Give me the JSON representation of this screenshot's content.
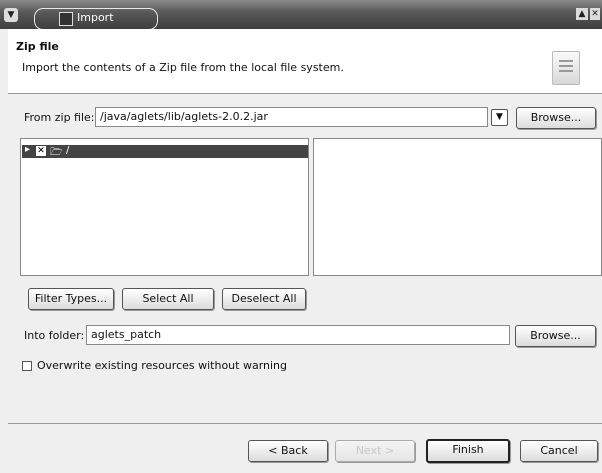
{
  "window": {
    "title": "Import"
  },
  "header": {
    "title": "Zip file",
    "description": "Import the contents of a Zip file from the local file system."
  },
  "source": {
    "label": "From zip file:",
    "value": "/java/aglets/lib/aglets-2.0.2.jar",
    "browse_label": "Browse..."
  },
  "tree": {
    "items": [
      {
        "label": "/",
        "checked": true,
        "expanded": false
      }
    ]
  },
  "buttons": {
    "filter_types": "Filter Types...",
    "select_all": "Select All",
    "deselect_all": "Deselect All"
  },
  "destination": {
    "label": "Into folder:",
    "value": "aglets_patch",
    "browse_label": "Browse..."
  },
  "options": {
    "overwrite_label": "Overwrite existing resources without warning",
    "overwrite_checked": false
  },
  "nav": {
    "back": "< Back",
    "next": "Next >",
    "finish": "Finish",
    "cancel": "Cancel"
  }
}
